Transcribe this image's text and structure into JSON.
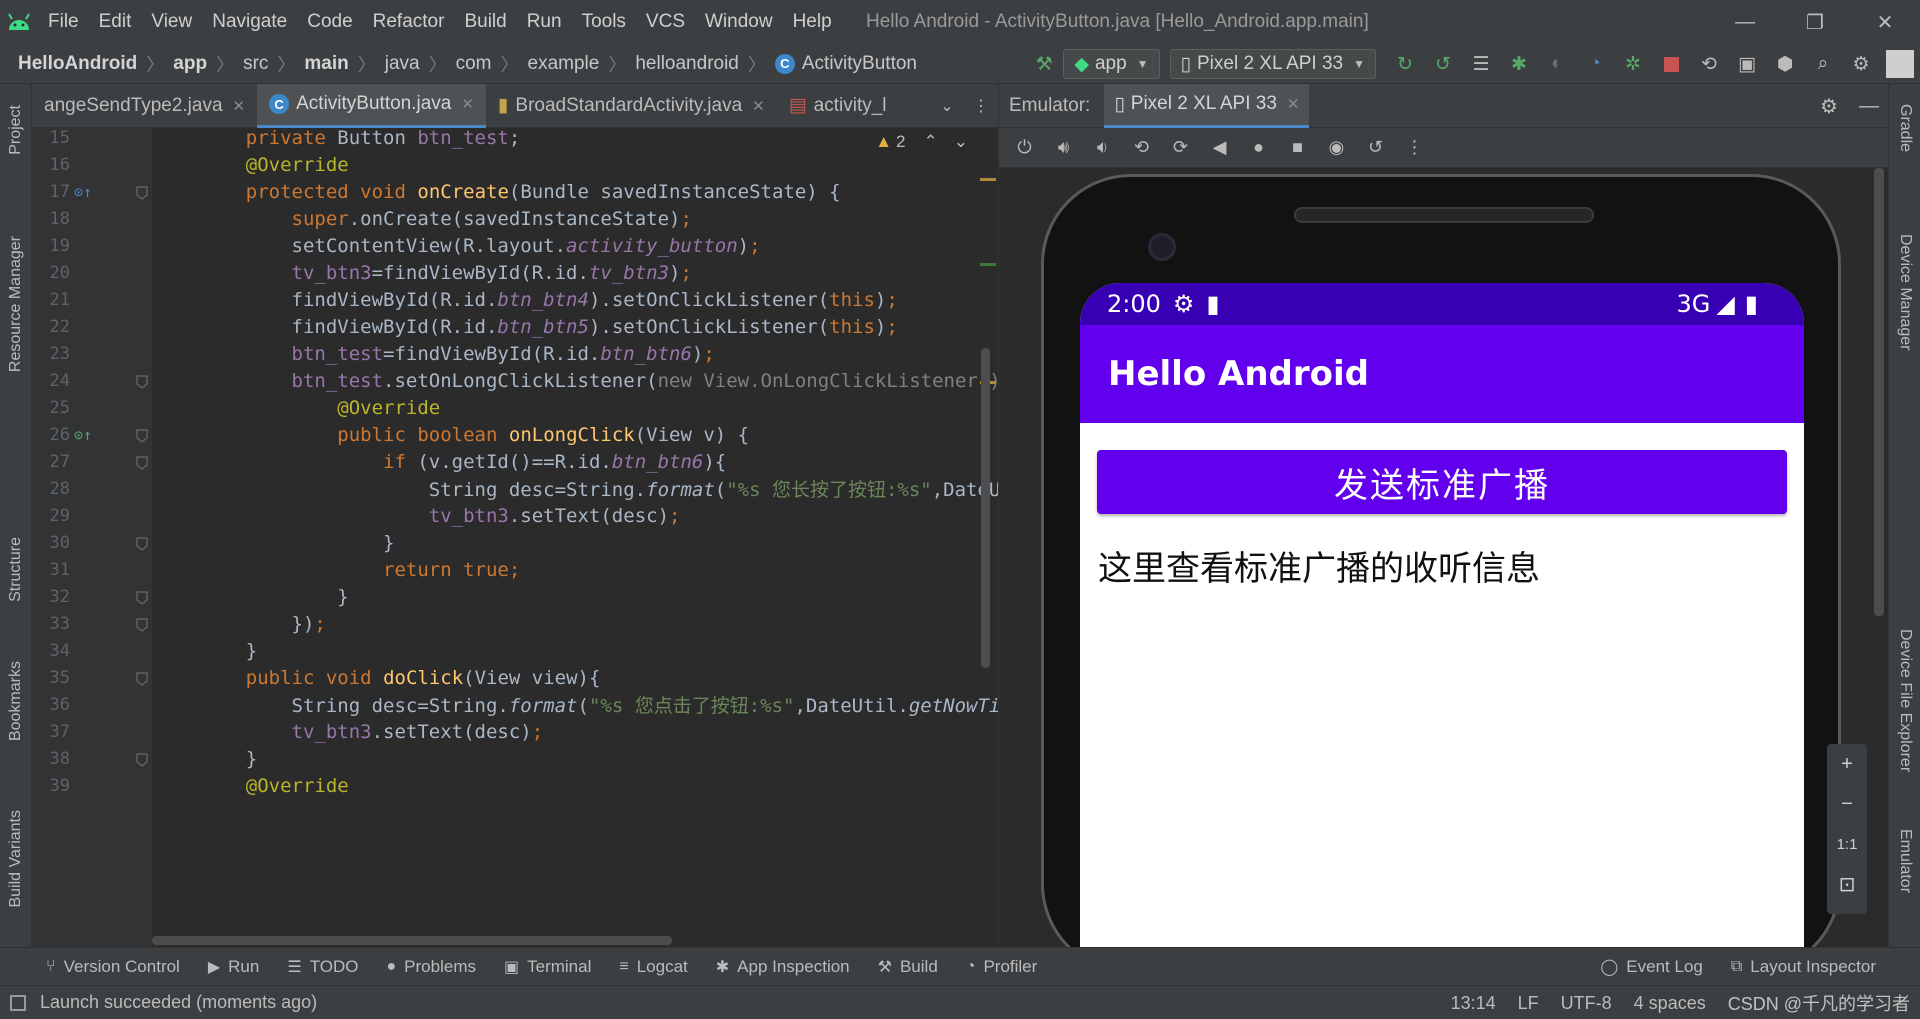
{
  "window": {
    "title": "Hello Android - ActivityButton.java [Hello_Android.app.main]",
    "menu": [
      "File",
      "Edit",
      "View",
      "Navigate",
      "Code",
      "Refactor",
      "Build",
      "Run",
      "Tools",
      "VCS",
      "Window",
      "Help"
    ],
    "minimize": "—",
    "restore": "❐",
    "close": "✕"
  },
  "breadcrumb": [
    "HelloAndroid",
    "app",
    "src",
    "main",
    "java",
    "com",
    "example",
    "helloandroid",
    "ActivityButton"
  ],
  "toolbar": {
    "run_config": "app",
    "device": "Pixel 2 XL API 33"
  },
  "left_tools": [
    "Project",
    "Resource Manager",
    "Structure",
    "Bookmarks",
    "Build Variants"
  ],
  "right_tools": [
    "Gradle",
    "Device Manager",
    "Device File Explorer",
    "Emulator"
  ],
  "editor_tabs": [
    {
      "label": "angeSendType2.java",
      "active": false
    },
    {
      "label": "ActivityButton.java",
      "active": true
    },
    {
      "label": "BroadStandardActivity.java",
      "active": false
    },
    {
      "label": "activity_l",
      "active": false
    }
  ],
  "warnings_count": "2",
  "code_lines": [
    {
      "n": "15",
      "html": "    <span class='kw'>private</span> Button <span class='fld'>btn_test</span>;"
    },
    {
      "n": "16",
      "html": "    <span class='ann'>@Override</span>"
    },
    {
      "n": "17",
      "html": "    <span class='kw'>protected void</span> <span class='fn'>onCreate</span>(Bundle savedInstanceState) {"
    },
    {
      "n": "18",
      "html": "        <span class='kw'>super</span>.onCreate(savedInstanceState)<span class='kw'>;</span>"
    },
    {
      "n": "19",
      "html": "        setContentView(R.layout.<span class='fld-i'>activity_button</span>)<span class='kw'>;</span>"
    },
    {
      "n": "20",
      "html": "        <span class='fld'>tv_btn3</span>=findViewById(R.id.<span class='fld-i'>tv_btn3</span>)<span class='kw'>;</span>"
    },
    {
      "n": "21",
      "html": "        findViewById(R.id.<span class='fld-i'>btn_btn4</span>).setOnClickListener(<span class='kw'>this</span>)<span class='kw'>;</span>"
    },
    {
      "n": "22",
      "html": "        findViewById(R.id.<span class='fld-i'>btn_btn5</span>).setOnClickListener(<span class='kw'>this</span>)<span class='kw'>;</span>"
    },
    {
      "n": "23",
      "html": "        <span class='fld'>btn_test</span>=findViewById(R.id.<span class='fld-i'>btn_btn6</span>)<span class='kw'>;</span>"
    },
    {
      "n": "24",
      "html": "        <span class='fld'>btn_test</span>.setOnLongClickListener(<span class='cmt'>new View.OnLongClickListener()</span>"
    },
    {
      "n": "25",
      "html": "            <span class='ann'>@Override</span>"
    },
    {
      "n": "26",
      "html": "            <span class='kw'>public boolean</span> <span class='fn'>onLongClick</span>(View v) {"
    },
    {
      "n": "27",
      "html": "                <span class='kw'>if</span> (v.getId()==R.id.<span class='fld-i'>btn_btn6</span>){"
    },
    {
      "n": "28",
      "html": "                    String desc=String.<span class='fmt'>format</span>(<span class='str'>\"%s 您长按了按钮:%s\"</span>,DateUt"
    },
    {
      "n": "29",
      "html": "                    <span class='fld'>tv_btn3</span>.setText(desc)<span class='kw'>;</span>"
    },
    {
      "n": "30",
      "html": "                }"
    },
    {
      "n": "31",
      "html": "                <span class='kw'>return true;</span>"
    },
    {
      "n": "32",
      "html": "            }"
    },
    {
      "n": "33",
      "html": "        })<span class='kw'>;</span>"
    },
    {
      "n": "34",
      "html": "    }"
    },
    {
      "n": "35",
      "html": "    <span class='kw'>public void</span> <span class='fn'>doClick</span>(View view){"
    },
    {
      "n": "36",
      "html": "        String desc=String.<span class='fmt'>format</span>(<span class='str'>\"%s 您点击了按钮:%s\"</span>,DateUtil.<span class='fmt'>getNowTim</span>"
    },
    {
      "n": "37",
      "html": "        <span class='fld'>tv_btn3</span>.setText(desc)<span class='kw'>;</span>"
    },
    {
      "n": "38",
      "html": "    }"
    },
    {
      "n": "39",
      "html": "    <span class='ann'>@Override</span>"
    }
  ],
  "emulator": {
    "label": "Emulator:",
    "device_tab": "Pixel 2 XL API 33",
    "phone": {
      "time": "2:00",
      "network": "3G",
      "app_title": "Hello Android",
      "button_label": "发送标准广播",
      "info_text": "这里查看标准广播的收听信息"
    },
    "zoom": {
      "plus": "+",
      "minus": "−",
      "actual": "1:1",
      "fit": "⊡"
    }
  },
  "bottom_tools": [
    "Version Control",
    "Run",
    "TODO",
    "Problems",
    "Terminal",
    "Logcat",
    "App Inspection",
    "Build",
    "Profiler"
  ],
  "bottom_tools_right": [
    "Event Log",
    "Layout Inspector"
  ],
  "status": {
    "message": "Launch succeeded (moments ago)",
    "position": "13:14",
    "line_sep": "LF",
    "encoding": "UTF-8",
    "indent": "4 spaces",
    "watermark": "CSDN @千凡的学习者"
  }
}
